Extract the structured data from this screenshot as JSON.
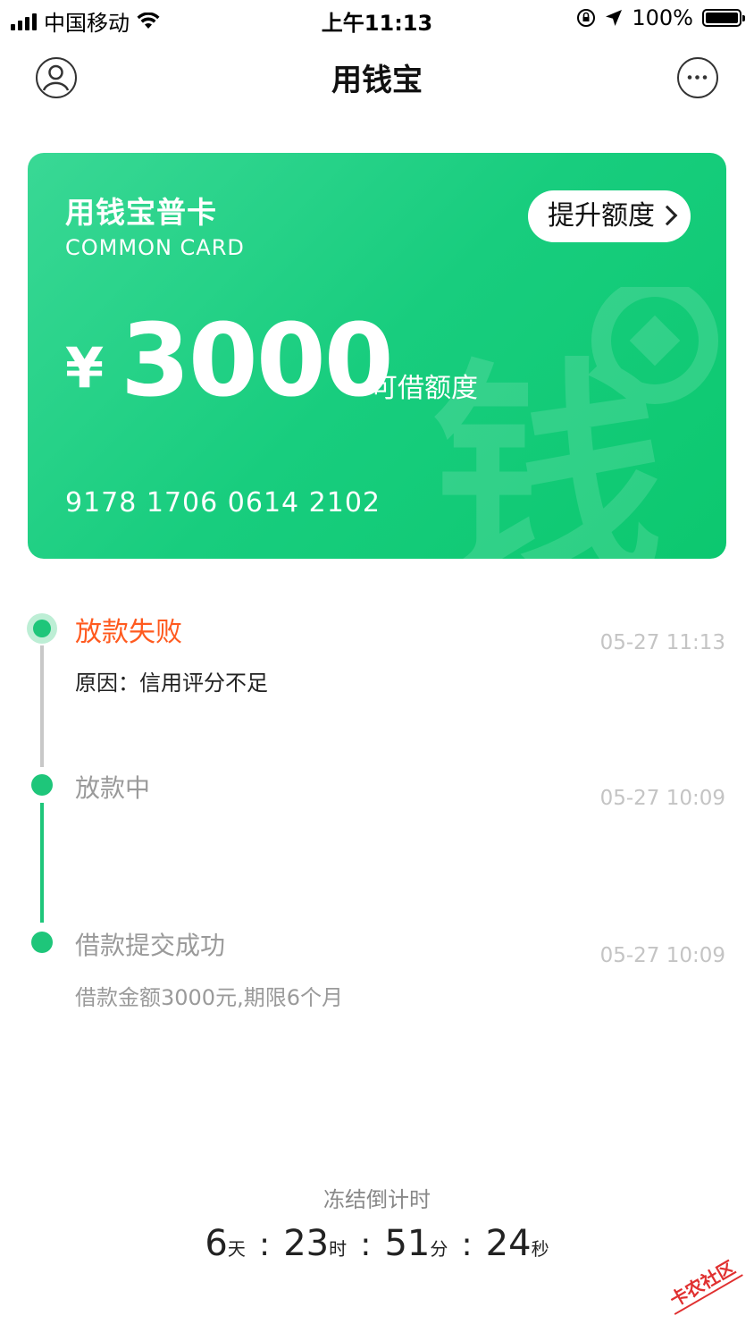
{
  "status_bar": {
    "carrier": "中国移动",
    "time": "上午11:13",
    "battery": "100%"
  },
  "nav": {
    "title": "用钱宝"
  },
  "card": {
    "title": "用钱宝普卡",
    "subtitle": "COMMON CARD",
    "upgrade_button": "提升额度",
    "currency": "¥",
    "amount": "3000",
    "amount_label": "可借额度",
    "card_number": "9178  1706  0614  2102",
    "watermark_text": "钱"
  },
  "timeline": [
    {
      "title": "放款失败",
      "date": "05-27 11:13",
      "desc": "原因：信用评分不足",
      "title_color": "#ff5a1f"
    },
    {
      "title": "放款中",
      "date": "05-27 10:09",
      "desc": "",
      "title_color": "#9a9a9a"
    },
    {
      "title": "借款提交成功",
      "date": "05-27 10:09",
      "desc": "借款金额3000元,期限6个月",
      "title_color": "#9a9a9a"
    }
  ],
  "countdown": {
    "label": "冻结倒计时",
    "days": "6",
    "days_unit": "天",
    "hours": "23",
    "hours_unit": "时",
    "minutes": "51",
    "minutes_unit": "分",
    "seconds": "24",
    "seconds_unit": "秒",
    "separator": ":"
  },
  "watermark": "卡农社区",
  "colors": {
    "accent_green": "#1ec67a",
    "failure_orange": "#ff5a1f"
  }
}
